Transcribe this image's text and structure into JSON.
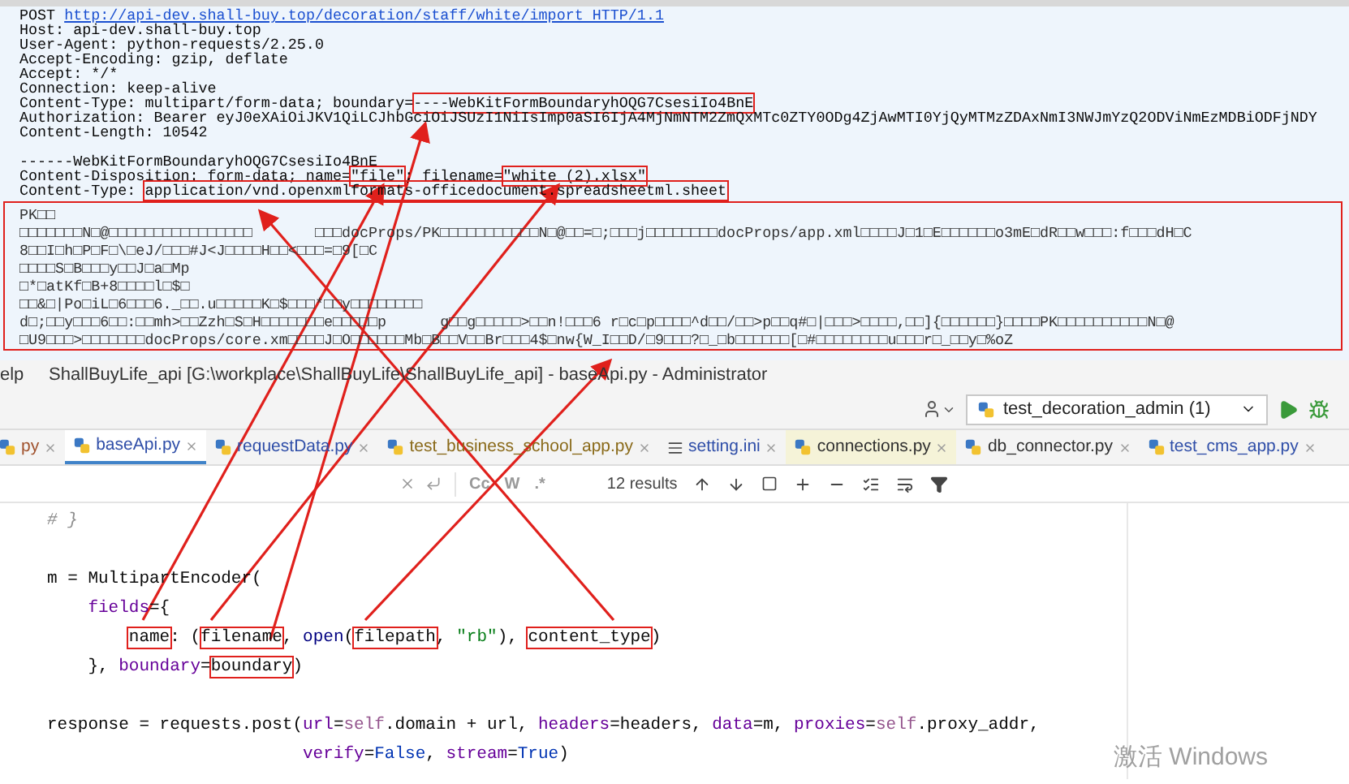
{
  "request": {
    "lines": [
      {
        "segments": [
          {
            "text": "POST ",
            "kind": "plain"
          },
          {
            "text": "http://api-dev.shall-buy.top/decoration/staff/white/import HTTP/1.1",
            "kind": "link"
          }
        ]
      },
      {
        "segments": [
          {
            "text": "Host: api-dev.shall-buy.top",
            "kind": "plain"
          }
        ]
      },
      {
        "segments": [
          {
            "text": "User-Agent: python-requests/2.25.0",
            "kind": "plain"
          }
        ]
      },
      {
        "segments": [
          {
            "text": "Accept-Encoding: gzip, deflate",
            "kind": "plain"
          }
        ]
      },
      {
        "segments": [
          {
            "text": "Accept: */*",
            "kind": "plain"
          }
        ]
      },
      {
        "segments": [
          {
            "text": "Connection: keep-alive",
            "kind": "plain"
          }
        ]
      },
      {
        "segments": [
          {
            "text": "Content-Type: multipart/form-data; boundary=",
            "kind": "plain"
          },
          {
            "text": "----WebKitFormBoundaryhOQG7CsesiIo4BnE",
            "kind": "plain",
            "boxed": true
          }
        ]
      },
      {
        "segments": [
          {
            "text": "Authorization: Bearer eyJ0eXAiOiJKV1QiLCJhbGciOiJSUzI1NiIsImp0aSI6IjA4MjNmNTM2ZmQxMTc0ZTY0ODg4ZjAwMTI0YjQyMTMzZDAxNmI3NWJmYzQ2ODViNmEzMDBiODFjNDY",
            "kind": "plain"
          }
        ]
      },
      {
        "segments": [
          {
            "text": "Content-Length: 10542",
            "kind": "plain"
          }
        ]
      },
      {
        "gap_before": true,
        "segments": [
          {
            "text": "------WebKitFormBoundaryhOQG7CsesiIo4BnE",
            "kind": "plain"
          }
        ]
      },
      {
        "segments": [
          {
            "text": "Content-Disposition: form-data; name=",
            "kind": "plain"
          },
          {
            "text": "\"file\"",
            "kind": "plain",
            "boxed": true
          },
          {
            "text": "; filename=",
            "kind": "plain"
          },
          {
            "text": "\"white (2).xlsx\"",
            "kind": "plain",
            "boxed": true
          }
        ]
      },
      {
        "segments": [
          {
            "text": "Content-Type: ",
            "kind": "plain"
          },
          {
            "text": "application/vnd.openxmlformats-officedocument.spreadsheetml.sheet",
            "kind": "plain",
            "boxed": true
          }
        ]
      }
    ],
    "body_boxed": true,
    "body": [
      "PK□□",
      "□□□□□□□N□@□□□□□□□□□□□□□□□□       □□□docProps/PK□□□□□□□□□□□N□@□□=□;□□□j□□□□□□□□docProps/app.xml□□□□J□1□E□□□□□□o3mE□dR□□w□□□:f□□□dH□C",
      "8□□I□h□P□F□\\□eJ/□□□#J<J□□□□H□□<□□□=□9[□C",
      "□□□□S□B□□□y□□J□a□Mp",
      "□*□atKf□B+8□□□□l□$□",
      "□□&□|Po□iL□6□□□6._□□.u□□□□□K□$□□□*□□y□□□□□□□□",
      "d□;□□y□□□6□□:□□mh>□□Zzh□S□H□□□□□□□e□□□□□p      g□□g□□□□□>□□n!□□□6 r□c□p□□□□^d□□/□□>p□□q#□|□□□>□□□□,□□]{□□□□□□}□□□□PK□□□□□□□□□□N□@",
      "□U9□□□>□□□□□□□docProps/core.xm□□□□J□O□□□□□□Mb□B□□V□□Br□□□4$□nw{W_I□□D/□9□□□?□_□b□□□□□□[□#□□□□□□□□u□□□r□_□□y□%oZ"
    ]
  },
  "ide": {
    "menu_fragment": "elp",
    "title": "ShallBuyLife_api [G:\\workplace\\ShallBuyLife\\ShallBuyLife_api] - baseApi.py - Administrator",
    "run_config": "test_decoration_admin (1)",
    "tabs": [
      {
        "label": "py",
        "kind": "python",
        "selected": false,
        "color": "#a0522d"
      },
      {
        "label": "baseApi.py",
        "kind": "python",
        "selected": true,
        "color": "#2f4ea8"
      },
      {
        "label": "requestData.py",
        "kind": "python",
        "selected": false,
        "color": "#2f4ea8"
      },
      {
        "label": "test_business_school_app.py",
        "kind": "python",
        "selected": false,
        "color": "#8a6a1a"
      },
      {
        "label": "setting.ini",
        "kind": "text",
        "selected": false,
        "color": "#2f4ea8"
      },
      {
        "label": "connections.py",
        "kind": "python",
        "selected": false,
        "color": "#303030",
        "highlighted": true
      },
      {
        "label": "db_connector.py",
        "kind": "python",
        "selected": false,
        "color": "#303030"
      },
      {
        "label": "test_cms_app.py",
        "kind": "python",
        "selected": false,
        "color": "#2f4ea8"
      }
    ],
    "search": {
      "toggles": [
        "Cc",
        "W",
        ".*"
      ],
      "results": "12 results"
    },
    "code": [
      {
        "segments": [
          {
            "text": "# }",
            "kind": "comment"
          }
        ]
      },
      {
        "kind": "blank"
      },
      {
        "segments": [
          {
            "text": "m = MultipartEncoder(",
            "kind": "plain"
          }
        ],
        "children": [
          {
            "segments": [
              {
                "text": "fields",
                "kind": "param"
              },
              {
                "text": "={",
                "kind": "plain"
              }
            ],
            "children": [
              {
                "segments": [
                  {
                    "text": "name",
                    "kind": "plain",
                    "boxed": true
                  },
                  {
                    "text": ": (",
                    "kind": "plain"
                  },
                  {
                    "text": "filename",
                    "kind": "plain",
                    "boxed": true
                  },
                  {
                    "text": ", ",
                    "kind": "plain"
                  },
                  {
                    "text": "open",
                    "kind": "builtin"
                  },
                  {
                    "text": "(",
                    "kind": "plain"
                  },
                  {
                    "text": "filepath",
                    "kind": "plain",
                    "boxed": true
                  },
                  {
                    "text": ", ",
                    "kind": "plain"
                  },
                  {
                    "text": "\"rb\"",
                    "kind": "string"
                  },
                  {
                    "text": "), ",
                    "kind": "plain"
                  },
                  {
                    "text": "content_type",
                    "kind": "plain",
                    "boxed": true
                  },
                  {
                    "text": ")",
                    "kind": "plain"
                  }
                ]
              }
            ]
          },
          {
            "segments": [
              {
                "text": "}, ",
                "kind": "plain"
              },
              {
                "text": "boundary",
                "kind": "param"
              },
              {
                "text": "=",
                "kind": "plain"
              },
              {
                "text": "boundary",
                "kind": "plain",
                "boxed": true
              },
              {
                "text": ")",
                "kind": "plain"
              }
            ]
          }
        ]
      },
      {
        "kind": "blank"
      },
      {
        "segments": [
          {
            "text": "response = requests.post(",
            "kind": "plain"
          },
          {
            "text": "url",
            "kind": "param"
          },
          {
            "text": "=",
            "kind": "plain"
          },
          {
            "text": "self",
            "kind": "self"
          },
          {
            "text": ".domain + url, ",
            "kind": "plain"
          },
          {
            "text": "headers",
            "kind": "param"
          },
          {
            "text": "=headers, ",
            "kind": "plain"
          },
          {
            "text": "data",
            "kind": "param"
          },
          {
            "text": "=m, ",
            "kind": "plain"
          },
          {
            "text": "proxies",
            "kind": "param"
          },
          {
            "text": "=",
            "kind": "plain"
          },
          {
            "text": "self",
            "kind": "self"
          },
          {
            "text": ".proxy_addr,",
            "kind": "plain"
          }
        ],
        "continuation": [
          {
            "segments": [
              {
                "text": "verify",
                "kind": "param"
              },
              {
                "text": "=",
                "kind": "plain"
              },
              {
                "text": "False",
                "kind": "const"
              },
              {
                "text": ", ",
                "kind": "plain"
              },
              {
                "text": "stream",
                "kind": "param"
              },
              {
                "text": "=",
                "kind": "plain"
              },
              {
                "text": "True",
                "kind": "const"
              },
              {
                "text": ")",
                "kind": "plain"
              }
            ]
          }
        ]
      }
    ]
  },
  "os_notice": "激活 Windows"
}
